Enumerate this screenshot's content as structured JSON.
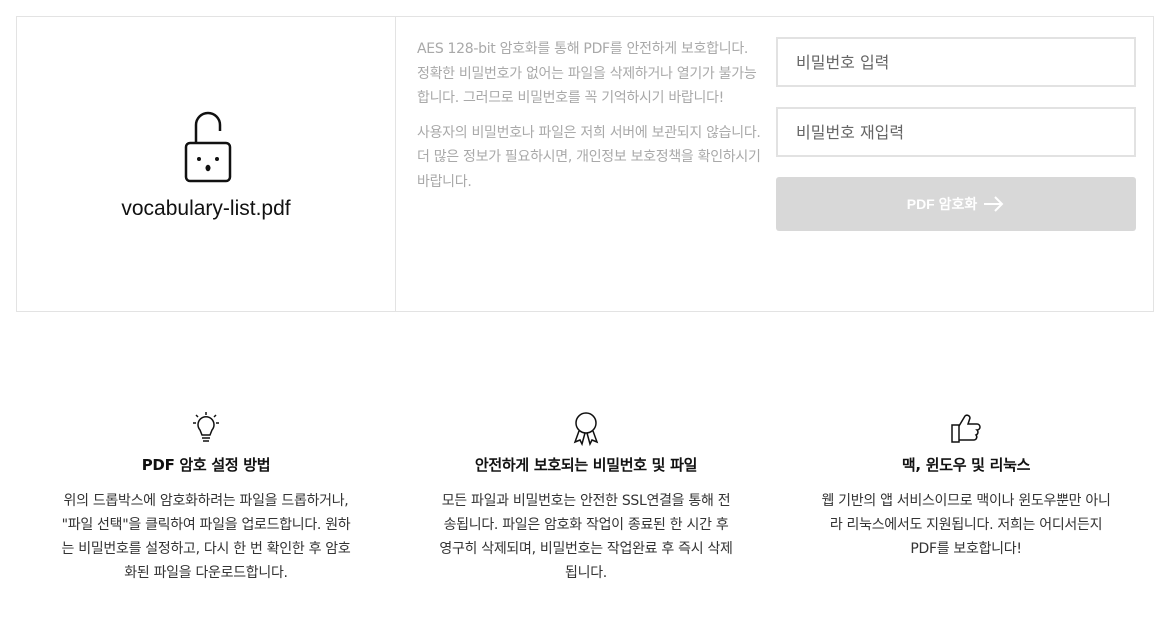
{
  "file": {
    "name": "vocabulary-list.pdf",
    "icon": "unlocked-padlock-icon"
  },
  "info": {
    "paragraph1": "AES 128-bit 암호화를 통해 PDF를 안전하게 보호합니다. 정확한 비밀번호가 없어는 파일을 삭제하거나 열기가 불가능합니다. 그러므로 비밀번호를 꼭 기억하시기 바랍니다!",
    "paragraph2": "사용자의 비밀번호나 파일은 저희 서버에 보관되지 않습니다. 더 많은 정보가 필요하시면, 개인정보 보호정책을 확인하시기 바랍니다."
  },
  "form": {
    "password_placeholder": "비밀번호 입력",
    "password_confirm_placeholder": "비밀번호 재입력",
    "submit_label": "PDF 암호화",
    "submit_icon": "arrow-right-icon",
    "submit_color": "#d8d8d8"
  },
  "features": [
    {
      "icon": "lightbulb-icon",
      "title": "PDF 암호 설정 방법",
      "text": "위의 드롭박스에 암호화하려는 파일을 드롭하거나, \"파일 선택\"을 클릭하여 파일을 업로드합니다. 원하는 비밀번호를 설정하고, 다시 한 번 확인한 후 암호화된 파일을 다운로드합니다."
    },
    {
      "icon": "award-ribbon-icon",
      "title": "안전하게 보호되는 비밀번호 및 파일",
      "text": "모든 파일과 비밀번호는 안전한 SSL연결을 통해 전송됩니다. 파일은 암호화 작업이 종료된 한 시간 후 영구히 삭제되며, 비밀번호는 작업완료 후 즉시 삭제됩니다."
    },
    {
      "icon": "thumbs-up-icon",
      "title": "맥, 윈도우 및 리눅스",
      "text": "웹 기반의 앱 서비스이므로 맥이나 윈도우뿐만 아니라 리눅스에서도 지원됩니다. 저희는 어디서든지 PDF를 보호합니다!"
    }
  ]
}
